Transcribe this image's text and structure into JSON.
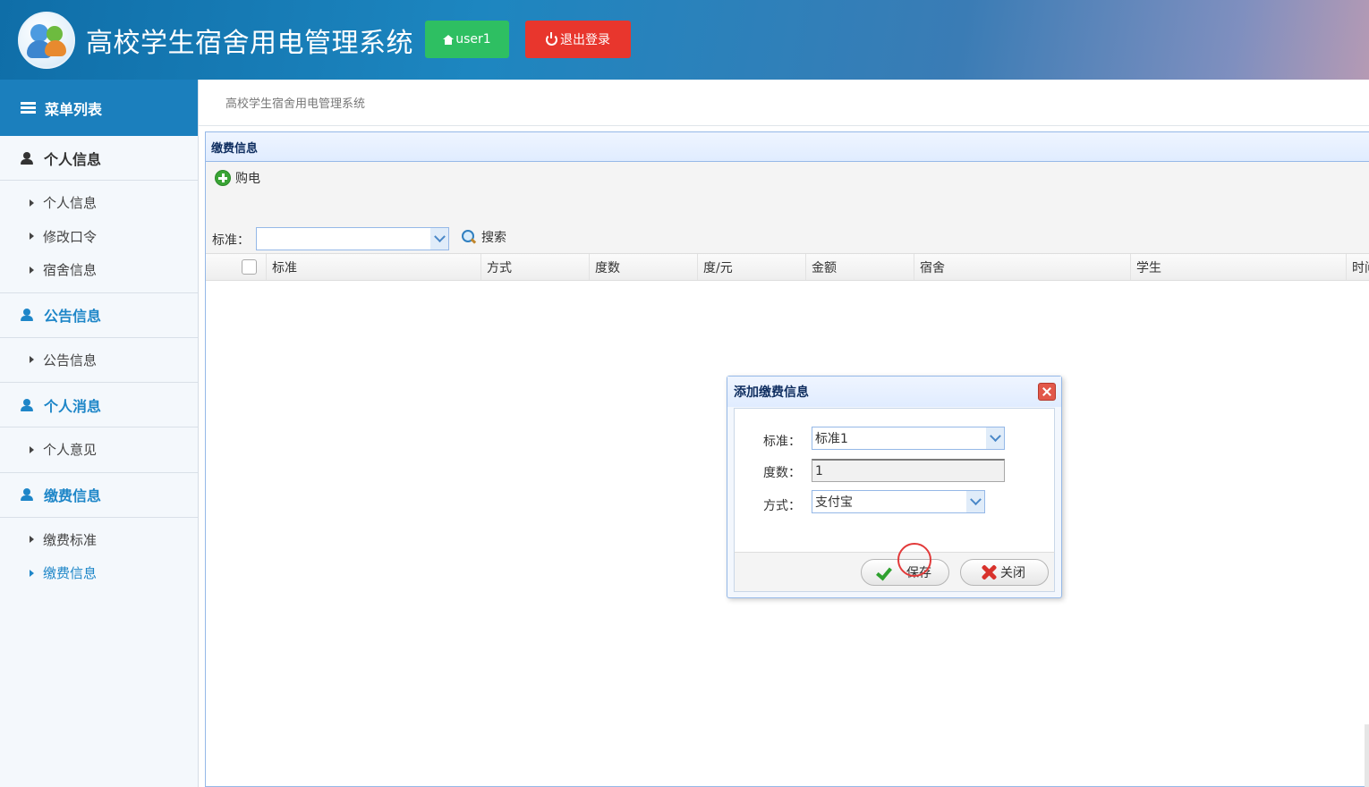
{
  "header": {
    "app_title": "高校学生宿舍用电管理系统",
    "user_label": "user1",
    "logout_label": "退出登录",
    "colors": {
      "user_button": "#2ebf62",
      "logout_button": "#e8362d",
      "header_bg": "#1b7fbd"
    }
  },
  "sidebar": {
    "heading": "菜单列表",
    "groups": [
      {
        "label": "个人信息",
        "items": [
          "个人信息",
          "修改口令",
          "宿舍信息"
        ]
      },
      {
        "label": "公告信息",
        "items": [
          "公告信息"
        ]
      },
      {
        "label": "个人消息",
        "items": [
          "个人意见"
        ]
      },
      {
        "label": "缴费信息",
        "items": [
          "缴费标准",
          "缴费信息"
        ]
      }
    ],
    "active_item": "缴费信息"
  },
  "breadcrumb": "高校学生宿舍用电管理系统",
  "panel": {
    "title": "缴费信息",
    "toolbar": {
      "buy_label": "购电",
      "filter_label": "标准：",
      "filter_value": "",
      "search_label": "搜索"
    },
    "columns": [
      "标准",
      "方式",
      "度数",
      "度/元",
      "金额",
      "宿舍",
      "学生",
      "时间"
    ]
  },
  "dialog": {
    "title": "添加缴费信息",
    "fields": [
      {
        "label": "标准：",
        "value": "标准1"
      },
      {
        "label": "度数：",
        "value": "1"
      },
      {
        "label": "方式：",
        "value": "支付宝"
      }
    ],
    "save_label": "保存",
    "close_label": "关闭"
  }
}
